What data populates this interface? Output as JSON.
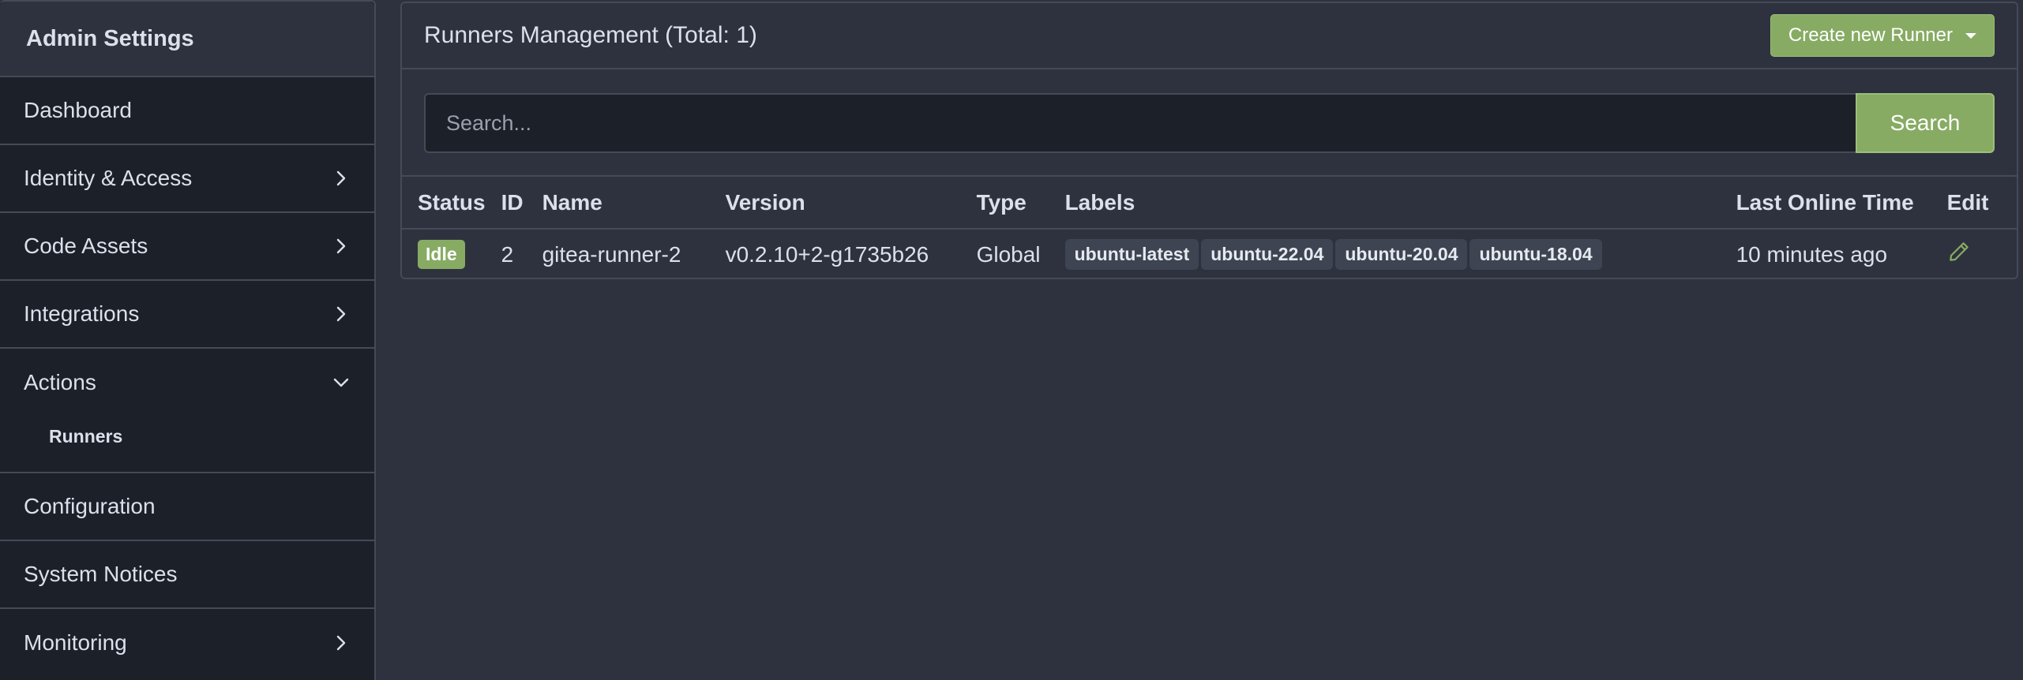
{
  "sidebar": {
    "title": "Admin Settings",
    "items": [
      {
        "label": "Dashboard",
        "icon": null
      },
      {
        "label": "Identity & Access",
        "icon": "chevron-right-icon"
      },
      {
        "label": "Code Assets",
        "icon": "chevron-right-icon"
      },
      {
        "label": "Integrations",
        "icon": "chevron-right-icon"
      },
      {
        "label": "Actions",
        "icon": "chevron-down-icon",
        "children": [
          {
            "label": "Runners"
          }
        ]
      },
      {
        "label": "Configuration",
        "icon": null
      },
      {
        "label": "System Notices",
        "icon": null
      },
      {
        "label": "Monitoring",
        "icon": "chevron-right-icon"
      }
    ]
  },
  "main": {
    "title": "Runners Management (Total: 1)",
    "create_button": "Create new Runner",
    "search": {
      "placeholder": "Search...",
      "button": "Search"
    },
    "table": {
      "headers": [
        "Status",
        "ID",
        "Name",
        "Version",
        "Type",
        "Labels",
        "Last Online Time",
        "Edit"
      ],
      "rows": [
        {
          "status": "Idle",
          "id": "2",
          "name": "gitea-runner-2",
          "version": "v0.2.10+2-g1735b26",
          "type": "Global",
          "labels": [
            "ubuntu-latest",
            "ubuntu-22.04",
            "ubuntu-20.04",
            "ubuntu-18.04"
          ],
          "last_online": "10 minutes ago",
          "edit_icon": "pencil-icon"
        }
      ]
    }
  },
  "colors": {
    "accent": "#87ab63",
    "background": "#2e323e",
    "sidebar_bg": "#1c2029",
    "border": "#454a57",
    "text": "#dbe0ea"
  }
}
